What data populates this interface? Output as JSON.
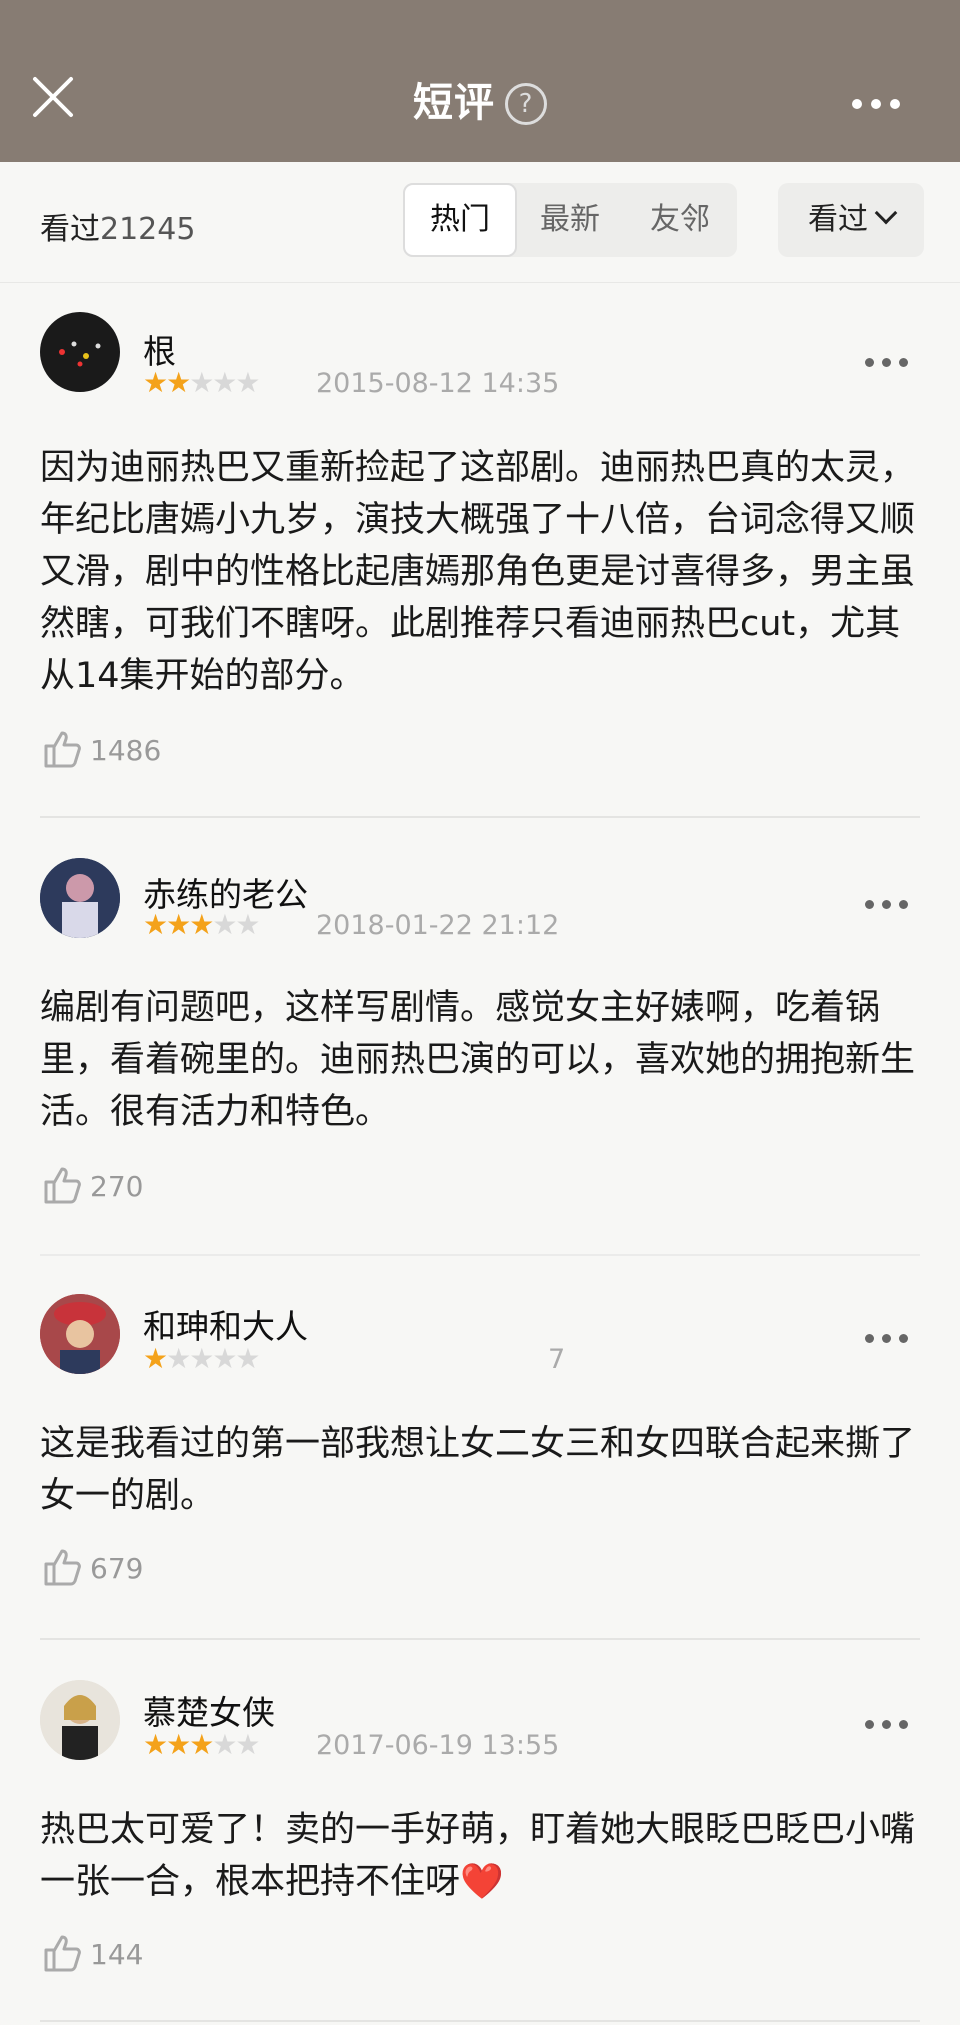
{
  "header": {
    "title": "短评",
    "help_icon": "?"
  },
  "filter": {
    "watched_label": "看过",
    "watched_count": "21245",
    "tabs": [
      "热门",
      "最新",
      "友邻"
    ],
    "dropdown_label": "看过"
  },
  "reviews": [
    {
      "name": "根",
      "stars": 2,
      "date": "2015-08-12 14:35",
      "text": "因为迪丽热巴又重新捡起了这部剧。迪丽热巴真的太灵，年纪比唐嫣小九岁，演技大概强了十八倍，台词念得又顺又滑，剧中的性格比起唐嫣那角色更是讨喜得多，男主虽然瞎，可我们不瞎呀。此剧推荐只看迪丽热巴cut，尤其从14集开始的部分。",
      "likes": "1486"
    },
    {
      "name": "赤练的老公",
      "stars": 3,
      "date": "2018-01-22 21:12",
      "text": "编剧有问题吧，这样写剧情。感觉女主好婊啊，吃着锅里，看着碗里的。迪丽热巴演的可以，喜欢她的拥抱新生活。很有活力和特色。",
      "likes": "270"
    },
    {
      "name": "和珅和大人",
      "stars": 1,
      "date": "7",
      "text": "这是我看过的第一部我想让女二女三和女四联合起来撕了女一的剧。",
      "likes": "679"
    },
    {
      "name": "慕楚女侠",
      "stars": 3,
      "date": "2017-06-19 13:55",
      "text": "热巴太可爱了！卖的一手好萌，盯着她大眼眨巴眨巴小嘴一张一合，根本把持不住呀❤️",
      "likes": "144"
    }
  ],
  "colors": {
    "header_bg": "#877c73",
    "star": "#f4a21a"
  }
}
